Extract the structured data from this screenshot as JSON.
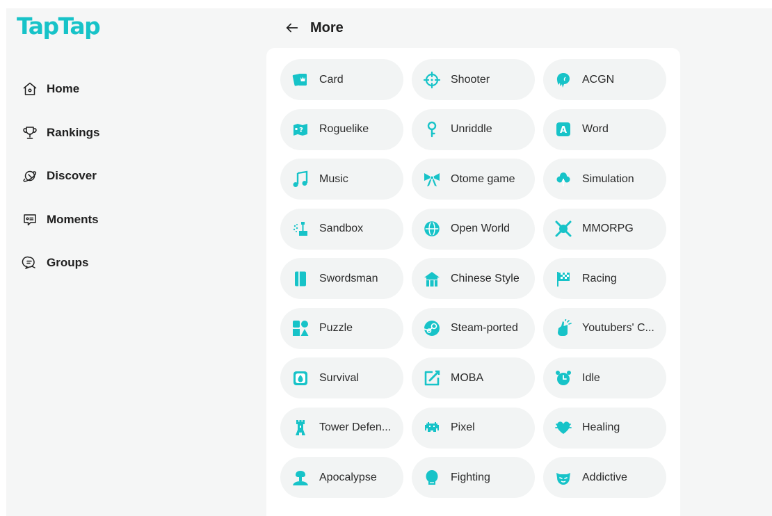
{
  "app": {
    "logo": "TapTap"
  },
  "sidebar": {
    "items": [
      {
        "label": "Home",
        "icon": "home-icon"
      },
      {
        "label": "Rankings",
        "icon": "trophy-icon"
      },
      {
        "label": "Discover",
        "icon": "planet-icon"
      },
      {
        "label": "Moments",
        "icon": "moments-icon"
      },
      {
        "label": "Groups",
        "icon": "groups-icon"
      }
    ]
  },
  "header": {
    "back_icon": "arrow-left-icon",
    "title": "More"
  },
  "colors": {
    "brand": "#17c3c8",
    "sidebar_bg": "#f5f6f6",
    "pill_bg": "#f2f4f4"
  },
  "tags": [
    {
      "label": "Card",
      "icon": "cards-icon"
    },
    {
      "label": "Shooter",
      "icon": "crosshair-icon"
    },
    {
      "label": "ACGN",
      "icon": "anime-head-icon"
    },
    {
      "label": "Roguelike",
      "icon": "map-question-icon"
    },
    {
      "label": "Unriddle",
      "icon": "key-icon"
    },
    {
      "label": "Word",
      "icon": "letter-a-icon"
    },
    {
      "label": "Music",
      "icon": "music-note-icon"
    },
    {
      "label": "Otome game",
      "icon": "bow-icon"
    },
    {
      "label": "Simulation",
      "icon": "tree-icon"
    },
    {
      "label": "Sandbox",
      "icon": "sandbox-icon"
    },
    {
      "label": "Open World",
      "icon": "globe-icon"
    },
    {
      "label": "MMORPG",
      "icon": "crossed-swords-icon"
    },
    {
      "label": "Swordsman",
      "icon": "book-icon"
    },
    {
      "label": "Chinese Style",
      "icon": "pagoda-icon"
    },
    {
      "label": "Racing",
      "icon": "checkered-flag-icon"
    },
    {
      "label": "Puzzle",
      "icon": "shapes-icon"
    },
    {
      "label": "Steam-ported",
      "icon": "steam-icon"
    },
    {
      "label": "Youtubers' C...",
      "icon": "hand-icon"
    },
    {
      "label": "Survival",
      "icon": "survival-icon"
    },
    {
      "label": "MOBA",
      "icon": "edit-square-icon"
    },
    {
      "label": "Idle",
      "icon": "alarm-clock-icon"
    },
    {
      "label": "Tower Defen...",
      "icon": "tower-icon"
    },
    {
      "label": "Pixel",
      "icon": "space-invader-icon"
    },
    {
      "label": "Healing",
      "icon": "heart-icon"
    },
    {
      "label": "Apocalypse",
      "icon": "mushroom-cloud-icon"
    },
    {
      "label": "Fighting",
      "icon": "fighter-icon"
    },
    {
      "label": "Addictive",
      "icon": "cat-face-icon"
    }
  ]
}
